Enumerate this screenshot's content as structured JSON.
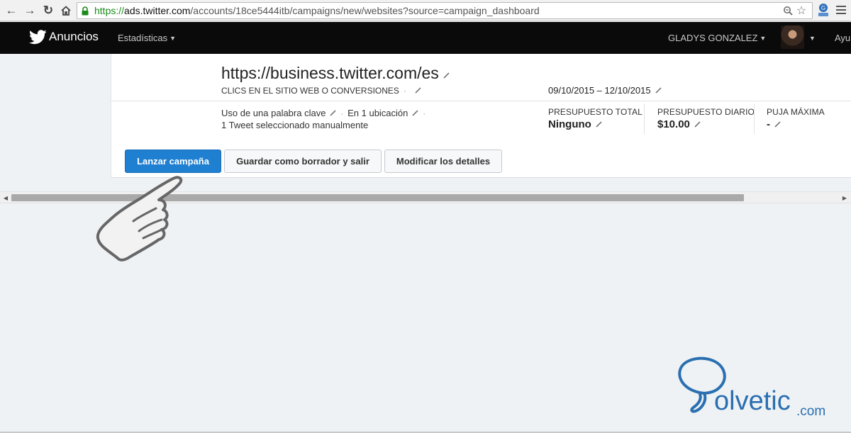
{
  "browser": {
    "url_scheme": "https://",
    "url_host": "ads.twitter.com",
    "url_path": "/accounts/18ce5444itb/campaigns/new/websites?source=campaign_dashboard",
    "icons": [
      "back-arrow-icon",
      "forward-arrow-icon",
      "reload-icon",
      "home-icon",
      "lock-icon",
      "zoom-icon",
      "star-icon",
      "extension-icon",
      "menu-icon"
    ]
  },
  "header": {
    "brand": "Anuncios",
    "nav_stats": "Estadísticas",
    "user_name": "GLADYS GONZALEZ",
    "help_partial": "Ayu"
  },
  "campaign": {
    "title": "https://business.twitter.com/es",
    "objective": "CLICS EN EL SITIO WEB O CONVERSIONES",
    "objective_dot": "·",
    "dates": "09/10/2015 – 12/10/2015",
    "keyword": "Uso de una palabra clave",
    "location": "En 1 ubicación",
    "sep": "·",
    "tweets": "1 Tweet seleccionado manualmente",
    "stats": [
      {
        "label": "PRESUPUESTO TOTAL",
        "value": "Ninguno"
      },
      {
        "label": "PRESUPUESTO DIARIO",
        "value": "$10.00"
      },
      {
        "label": "PUJA MÁXIMA",
        "value": "-"
      }
    ]
  },
  "actions": {
    "launch": "Lanzar campaña",
    "save_draft": "Guardar como borrador y salir",
    "modify": "Modificar los detalles"
  },
  "watermark": {
    "brand": "olvetic",
    "tld": ".com"
  },
  "colors": {
    "primary_button": "#1f7fd1",
    "appbar": "#0a0a0a",
    "background": "#eef2f5",
    "watermark": "#2a6fb0"
  }
}
